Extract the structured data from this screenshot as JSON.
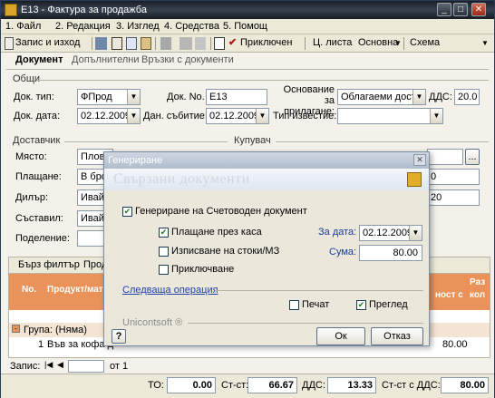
{
  "window": {
    "title": "Е13 - Фактура за продажба"
  },
  "menu": [
    "1. Файл",
    "2. Редакция",
    "3. Изглед",
    "4. Средства",
    "5. Помощ"
  ],
  "toolbar": {
    "save_exit": "Запис и изход",
    "post": "Приключен",
    "price_list": "Ц. листа",
    "price_list_value": "Основна",
    "scheme": "Схема"
  },
  "tabs": [
    "Документ",
    "Допълнителни",
    "Връзки с документи"
  ],
  "general": {
    "title": "Общи",
    "doc_type_label": "Док. тип:",
    "doc_type": "ФПрод",
    "doc_no_label": "Док. No.",
    "doc_no": "Е13",
    "basis_label": "Основание за прилагане:",
    "basis": "Облагаеми дост",
    "vat_label": "ДДС:",
    "vat": "20.0",
    "doc_date_label": "Док. дата:",
    "doc_date": "02.12.2009",
    "tax_event_label": "Дан. събитие:",
    "tax_event": "02.12.2009",
    "notice_label": "Тип известие:"
  },
  "supplier": {
    "title": "Доставчик",
    "place_label": "Място:",
    "place": "Пловд",
    "payment_label": "Плащане:",
    "payment": "В бро",
    "dealer_label": "Дилър:",
    "dealer": "Ивайл",
    "compiled_label": "Съставил:",
    "compiled": "Ивайл",
    "division_label": "Поделение:"
  },
  "buyer": {
    "title": "Купувач",
    "dots": "...",
    "v1": "0",
    "v2": "20"
  },
  "grid": {
    "filter_tab": "Бърз филтър",
    "product_tab": "Прод",
    "col_no": "No.",
    "col_product": "Продукт/мат",
    "col_right1": "ност с",
    "col_right2": "Раз",
    "col_right3": "кол",
    "group_label": "Група: (Няма)",
    "row1_no": "1",
    "row1_product": "Във за кофа д",
    "row1_value": "80.00"
  },
  "nav": {
    "record_label": "Запис:",
    "of": "от 1"
  },
  "status": {
    "to_label": "ТО:",
    "to": "0.00",
    "net_label": "Ст-ст:",
    "net": "66.67",
    "vat_label": "ДДС:",
    "vat": "13.33",
    "gross_label": "Ст-ст с ДДС:",
    "gross": "80.00"
  },
  "dialog": {
    "title": "Генериране",
    "header": "Свързани документи",
    "gen_acc": "Генериране на Счетоводен документ",
    "cash": "Плащане през каса",
    "for_date_label": "За дата:",
    "for_date": "02.12.2009",
    "stock_out": "Изписване на стоки/МЗ",
    "amount_label": "Сума:",
    "amount": "80.00",
    "post": "Приключване",
    "next_op": "Следваща операция",
    "print": "Печат",
    "preview": "Преглед",
    "brand": "Unicontsoft ®",
    "ok": "Ок",
    "cancel": "Отказ",
    "help": "?"
  },
  "colors": {
    "accent": "#e9935a",
    "titlebar": "#1f252d"
  }
}
